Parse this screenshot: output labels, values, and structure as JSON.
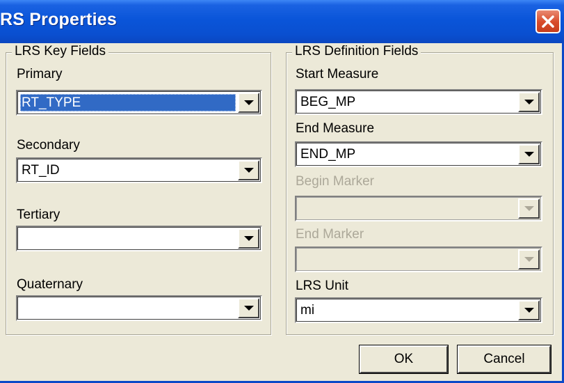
{
  "window": {
    "title": "RS Properties"
  },
  "key_fields": {
    "legend": "LRS Key Fields",
    "primary": {
      "label": "Primary",
      "value": "RT_TYPE"
    },
    "secondary": {
      "label": "Secondary",
      "value": "RT_ID"
    },
    "tertiary": {
      "label": "Tertiary",
      "value": ""
    },
    "quaternary": {
      "label": "Quaternary",
      "value": ""
    }
  },
  "definition_fields": {
    "legend": "LRS Definition Fields",
    "start_measure": {
      "label": "Start Measure",
      "value": "BEG_MP"
    },
    "end_measure": {
      "label": "End Measure",
      "value": "END_MP"
    },
    "begin_marker": {
      "label": "Begin Marker",
      "value": "",
      "enabled": false
    },
    "end_marker": {
      "label": "End Marker",
      "value": "",
      "enabled": false
    },
    "lrs_unit": {
      "label": "LRS Unit",
      "value": "mi"
    }
  },
  "buttons": {
    "ok": "OK",
    "cancel": "Cancel"
  },
  "icons": {
    "close": "close-icon",
    "dropdown": "chevron-down-icon"
  },
  "colors": {
    "titlebar": "#0a55d9",
    "close_button": "#d84b2a",
    "selection": "#316ac5",
    "dialog_background": "#ece9d8"
  }
}
